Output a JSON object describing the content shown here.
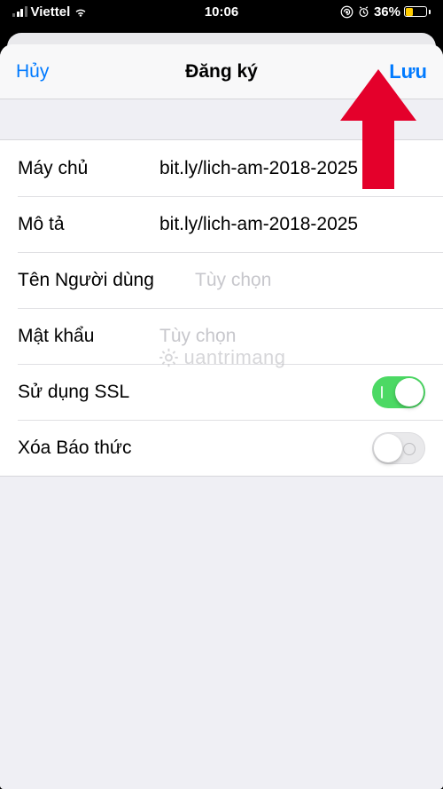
{
  "status": {
    "carrier": "Viettel",
    "time": "10:06",
    "battery_percent": "36%"
  },
  "nav": {
    "cancel": "Hủy",
    "title": "Đăng ký",
    "save": "Lưu"
  },
  "form": {
    "server_label": "Máy chủ",
    "server_value": "bit.ly/lich-am-2018-2025",
    "desc_label": "Mô tả",
    "desc_value": "bit.ly/lich-am-2018-2025",
    "username_label": "Tên Người dùng",
    "username_placeholder": "Tùy chọn",
    "password_label": "Mật khẩu",
    "password_placeholder": "Tùy chọn",
    "ssl_label": "Sử dụng SSL",
    "ssl_on": true,
    "remove_alarm_label": "Xóa Báo thức",
    "remove_alarm_on": false
  },
  "watermark": "uantrimang"
}
